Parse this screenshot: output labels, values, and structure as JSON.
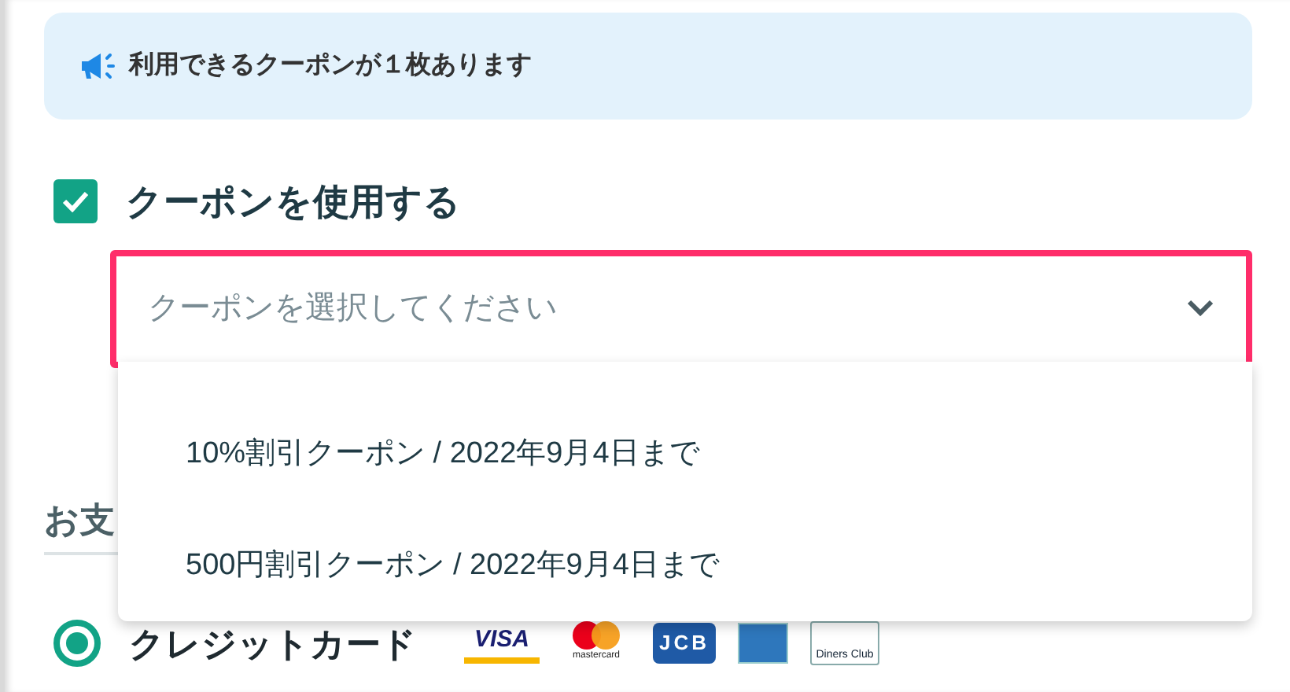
{
  "notice": {
    "text": "利用できるクーポンが１枚あります"
  },
  "use_coupon": {
    "label": "クーポンを使用する",
    "checked": true
  },
  "coupon_select": {
    "placeholder": "クーポンを選択してください",
    "expanded": true,
    "options": [
      {
        "label": "10%割引クーポン / 2022年9月4日まで"
      },
      {
        "label": "500円割引クーポン / 2022年9月4日まで"
      }
    ]
  },
  "payment_heading": "お支",
  "payment_methods": [
    {
      "label": "クレジットカード",
      "selected": true,
      "cards": [
        {
          "kind": "visa",
          "label": "VISA"
        },
        {
          "kind": "mastercard",
          "label": "mastercard"
        },
        {
          "kind": "jcb",
          "label": "JCB"
        },
        {
          "kind": "amex"
        },
        {
          "kind": "diners",
          "label": "Diners Club"
        }
      ]
    }
  ]
}
